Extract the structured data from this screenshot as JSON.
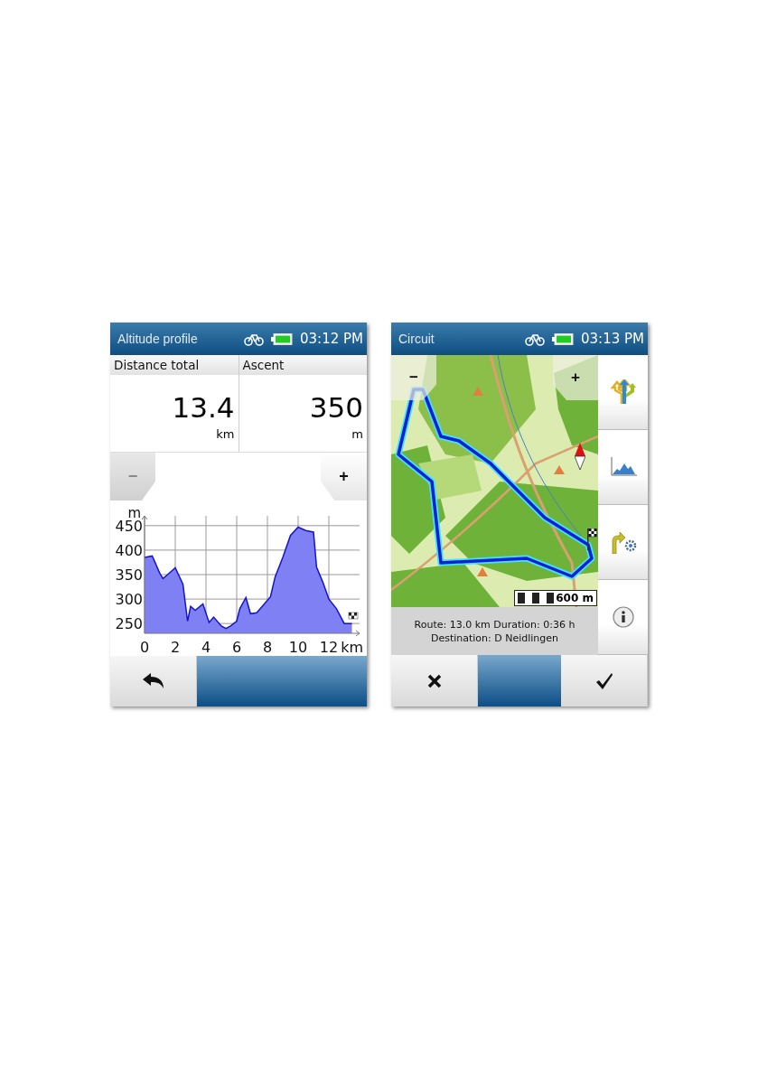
{
  "altitude_screen": {
    "title": "Altitude profile",
    "time": "03:12 PM",
    "stats": [
      {
        "label": "Distance total",
        "value": "13.4",
        "unit": "km"
      },
      {
        "label": "Ascent",
        "value": "350",
        "unit": "m"
      }
    ],
    "zoom_out": "−",
    "zoom_in": "+",
    "chart_data": {
      "type": "area",
      "xlabel": "km",
      "ylabel": "m",
      "x": [
        0,
        0.5,
        1,
        1.2,
        1.5,
        2,
        2.5,
        2.8,
        3,
        3.3,
        3.8,
        4.2,
        4.5,
        5,
        5.3,
        5.6,
        6,
        6.2,
        6.6,
        6.9,
        7.3,
        7.8,
        8.2,
        8.5,
        9,
        9.5,
        10,
        10.5,
        11,
        11.2,
        11.6,
        12,
        12.5,
        13,
        13.5
      ],
      "series": [
        {
          "color": "#7f80f4",
          "values": [
            385,
            388,
            352,
            342,
            350,
            364,
            330,
            255,
            285,
            277,
            290,
            252,
            263,
            245,
            240,
            245,
            255,
            280,
            303,
            270,
            272,
            290,
            305,
            345,
            385,
            430,
            447,
            440,
            437,
            365,
            335,
            300,
            280,
            250,
            250
          ]
        }
      ],
      "xlim": [
        0,
        14
      ],
      "ylim": [
        230,
        470
      ],
      "grid": true,
      "xticks": [
        0,
        2,
        4,
        6,
        8,
        10,
        12
      ],
      "yticks": [
        250,
        300,
        350,
        400,
        450
      ]
    }
  },
  "circuit_screen": {
    "title": "Circuit",
    "time": "03:13 PM",
    "zoom_out": "−",
    "zoom_in": "+",
    "scale": "600 m",
    "info_lines": [
      "Route: 13.0 km Duration: 0:36 h",
      "Destination: D Neidlingen"
    ]
  }
}
